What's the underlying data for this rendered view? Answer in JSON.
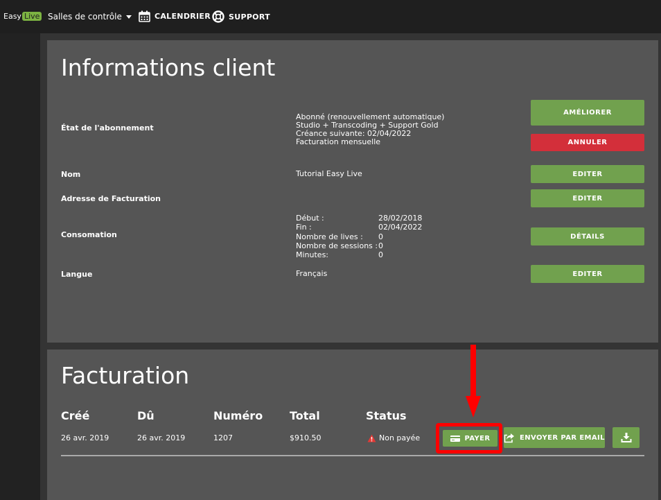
{
  "header": {
    "logo": {
      "easy": "Easy",
      "live": "Live"
    },
    "salles": "Salles de contrôle",
    "calendrier": "CALENDRIER",
    "support": "SUPPORT"
  },
  "client": {
    "title": "Informations client",
    "subscription": {
      "label": "État de l'abonnement",
      "lines": [
        "Abonné (renouvellement automatique)",
        "Studio + Transcoding + Support Gold",
        "Créance suivante: 02/04/2022",
        "Facturation mensuelle"
      ],
      "upgrade_button": "AMÉLIORER",
      "cancel_button": "ANNULER"
    },
    "name": {
      "label": "Nom",
      "value": "Tutorial Easy Live",
      "button": "EDITER"
    },
    "billing_address": {
      "label": "Adresse de Facturation",
      "button": "EDITER"
    },
    "consumption": {
      "label": "Consomation",
      "items": [
        {
          "key": "Début :",
          "value": "28/02/2018"
        },
        {
          "key": "Fin :",
          "value": "02/04/2022"
        },
        {
          "key": "Nombre de lives :",
          "value": "0"
        },
        {
          "key": "Nombre de sessions :",
          "value": "0"
        },
        {
          "key": "Minutes:",
          "value": "0"
        }
      ],
      "button": "DÉTAILS"
    },
    "language": {
      "label": "Langue",
      "value": "Français",
      "button": "EDITER"
    }
  },
  "billing": {
    "title": "Facturation",
    "headers": {
      "created": "Créé",
      "due": "Dû",
      "number": "Numéro",
      "total": "Total",
      "status": "Status"
    },
    "invoice": {
      "created": "26 avr. 2019",
      "due": "26 avr. 2019",
      "number": "1207",
      "total": "$910.50",
      "status": "Non payée"
    },
    "pay_button": "PAYER",
    "email_button": "ENVOYER PAR EMAIL"
  },
  "colors": {
    "accent_green": "#71a14e",
    "danger_red": "#d32f3a",
    "highlight_red": "#ff0000",
    "logo_green": "#7cb342"
  }
}
